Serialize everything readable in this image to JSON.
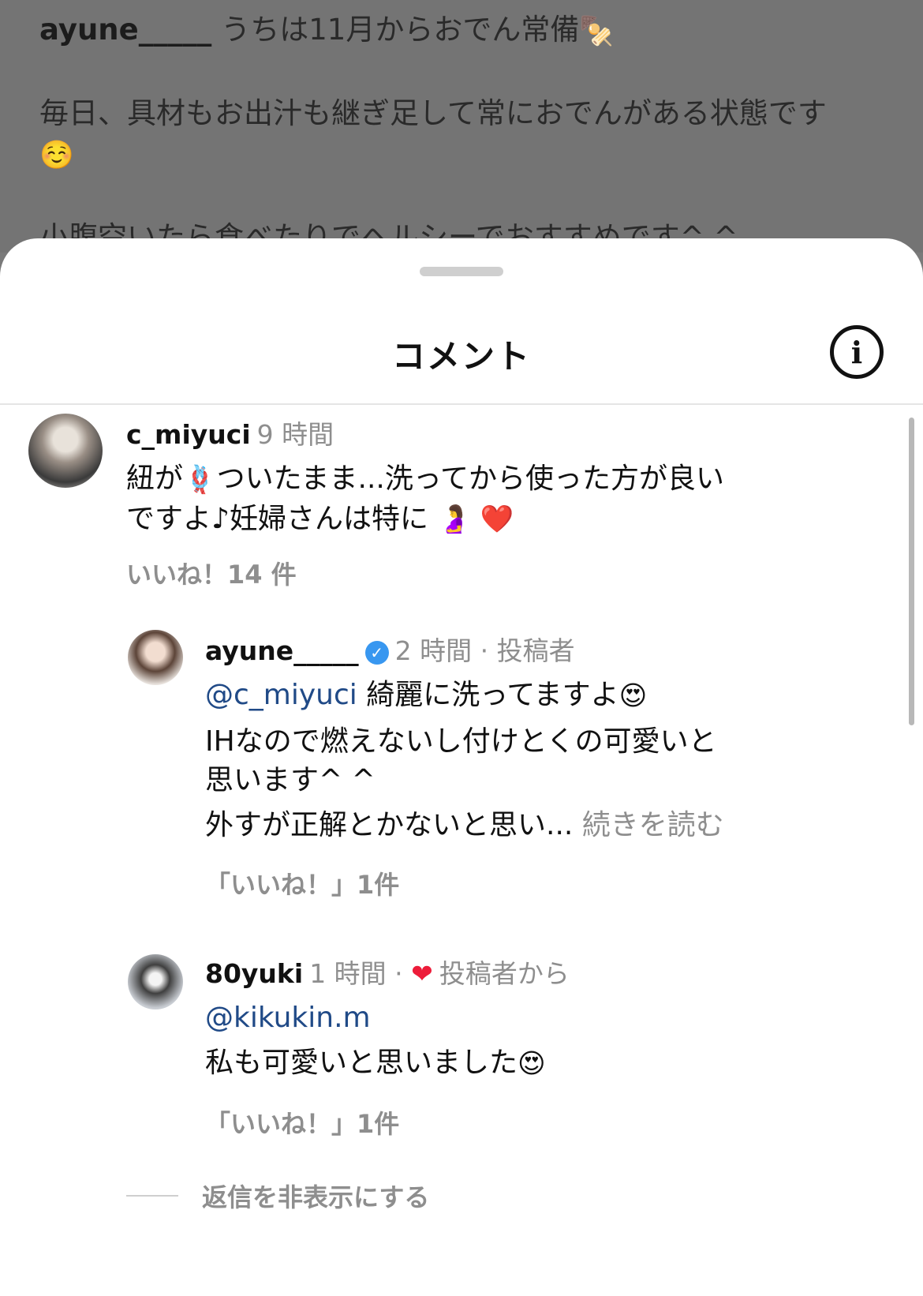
{
  "background_post": {
    "username": "ayune_____",
    "line1": "うちは11月からおでん常備",
    "line1_emoji": "🍢",
    "line2": "毎日、具材もお出汁も継ぎ足して常におでんがある状態です",
    "line2_emoji": "☺️",
    "line3": "小腹空いたら食べたりでヘルシーでおすすめです^ ^"
  },
  "sheet": {
    "title": "コメント",
    "info_icon": "info-icon"
  },
  "comments": [
    {
      "username": "c_miyuci",
      "time": "9 時間",
      "body_part1": "紐が",
      "emoji_knot": "🪢",
      "body_part2": "ついたまま...洗ってから使った方が良い",
      "body_line2": "ですよ♪妊婦さんは特に",
      "emoji_pregnant": "🤰",
      "emoji_heart": "❤️",
      "likes": "いいね！14 件"
    }
  ],
  "replies": [
    {
      "username": "ayune_____",
      "verified": true,
      "meta": "2 時間 · 投稿者",
      "mention": "@c_miyuci",
      "body_line1": " 綺麗に洗ってますよ",
      "emoji_love": "😍",
      "body_line2": "IHなので燃えないし付けとくの可愛いと",
      "body_line3": "思います^ ^",
      "body_line4": "外すが正解とかないと思い...",
      "read_more": "続きを読む",
      "likes": "「いいね！」1件"
    },
    {
      "username": "80yuki",
      "meta_time": "1 時間 ·",
      "meta_liked": "投稿者から",
      "mention": "@kikukin.m",
      "body_line1": "私も可愛いと思いました",
      "emoji_love": "😍",
      "likes": "「いいね！」1件"
    }
  ],
  "hide_replies": "返信を非表示にする"
}
